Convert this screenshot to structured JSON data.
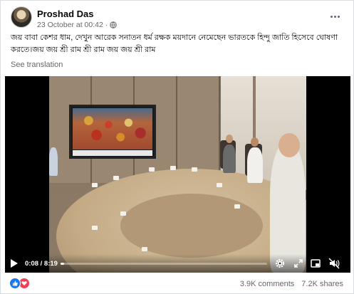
{
  "post": {
    "author": "Proshad Das",
    "date": "23 October at 00:42",
    "separator": "·",
    "privacy_icon": "globe-icon",
    "more_icon": "more-options-icon",
    "text": "জয় বাবা কেশর ধাম, দেখুন আরেক সনাতন ধর্ম রক্ষক ময়দানে নেমেছেন ভারতকে হিন্দু জাতি হিসেবে ঘোষণা করতে।জয় জয় শ্রী রাম শ্রী রাম জয় জয় শ্রী রাম",
    "see_translation": "See translation"
  },
  "video": {
    "time": "0:08 / 8:19",
    "progress_fraction": 0.016,
    "icons": [
      "play-icon",
      "settings-icon",
      "fullscreen-icon",
      "picture-in-picture-icon",
      "volume-icon"
    ]
  },
  "footer": {
    "reactions": [
      "like-icon",
      "love-icon"
    ],
    "comments": "3.9K comments",
    "shares": "7.2K shares"
  },
  "colors": {
    "like": "#1877f2",
    "love": "#f33e58",
    "secondary_text": "#65676b"
  }
}
